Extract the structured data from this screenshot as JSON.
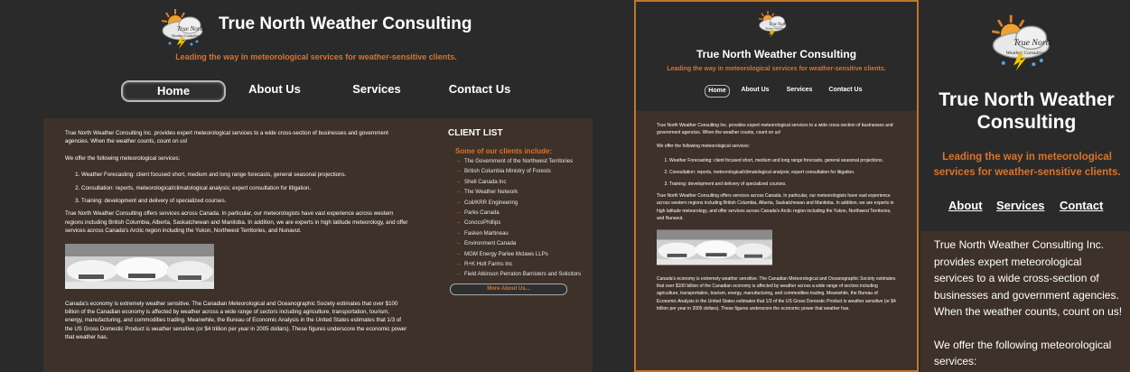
{
  "site": {
    "title": "True North Weather Consulting",
    "tagline": "Leading the way in meteorological services for weather-sensitive clients.",
    "logo_text_1": "True North",
    "logo_text_2": "Weather Consulting"
  },
  "nav": {
    "home": "Home",
    "about": "About Us",
    "services": "Services",
    "contact": "Contact Us"
  },
  "mobile_nav": {
    "about": "About",
    "services": "Services",
    "contact": "Contact"
  },
  "content": {
    "intro": "True North Weather Consulting Inc. provides expert meteorological services to a wide cross-section of businesses and government agencies. When the weather counts, count on us!",
    "offer_heading": "We offer the following meteorological services:",
    "services": [
      "Weather Forecasting: client focused short, medium and long range forecasts, general seasonal projections.",
      "Consultation: reports, meteorological/climatological analysis; expert consultation for litigation.",
      "Training: development and delivery of specialized courses."
    ],
    "coverage": "True North Weather Consulting offers services across Canada. In particular, our meteorologists have vast experience across western regions including British Columbia, Alberta, Saskatchewan and Manitoba. In addition, we are experts in high latitude meteorology, and offer services across Canada's Arctic region including the Yukon, Northwest Territories, and Nunavut.",
    "economy": "Canada's economy is extremely weather sensitive. The Canadian Meteorological and Oceanographic Society estimates that over $100 billion of the Canadian economy is affected by weather across a wide range of sectors including agriculture, transportation, tourism, energy, manufacturing, and commodities trading. Meanwhile, the Bureau of Economic Analysis in the United States estimates that 1/3 of the US Gross Domestic Product is weather sensitive (or $4 trillion per year in 2005 dollars). These figures underscore the economic power that weather has."
  },
  "sidebar": {
    "heading": "CLIENT LIST",
    "subheading": "Some of our clients include:",
    "clients": [
      "The Government of the Northwest Territories",
      "British Columbia Ministry of Forests",
      "Shell Canada Inc",
      "The Weather Network",
      "Coil/KRR Engineering",
      "Parks Canada",
      "ConocoPhillips",
      "Fasken Martineau",
      "Environment Canada",
      "MGM Energy Parlee Mclaws LLPs",
      "R+K Holt Farms Inc",
      "Field Atkinson Perraton Barristers and Solicitors"
    ],
    "more_button": "More About Us..."
  },
  "colors": {
    "background": "#2a2a2a",
    "content": "#3d3129",
    "accent": "#d9742c"
  },
  "icons": {
    "logo": "sun-cloud-lightning-logo",
    "photo": "snow-covered-cars-photo"
  }
}
